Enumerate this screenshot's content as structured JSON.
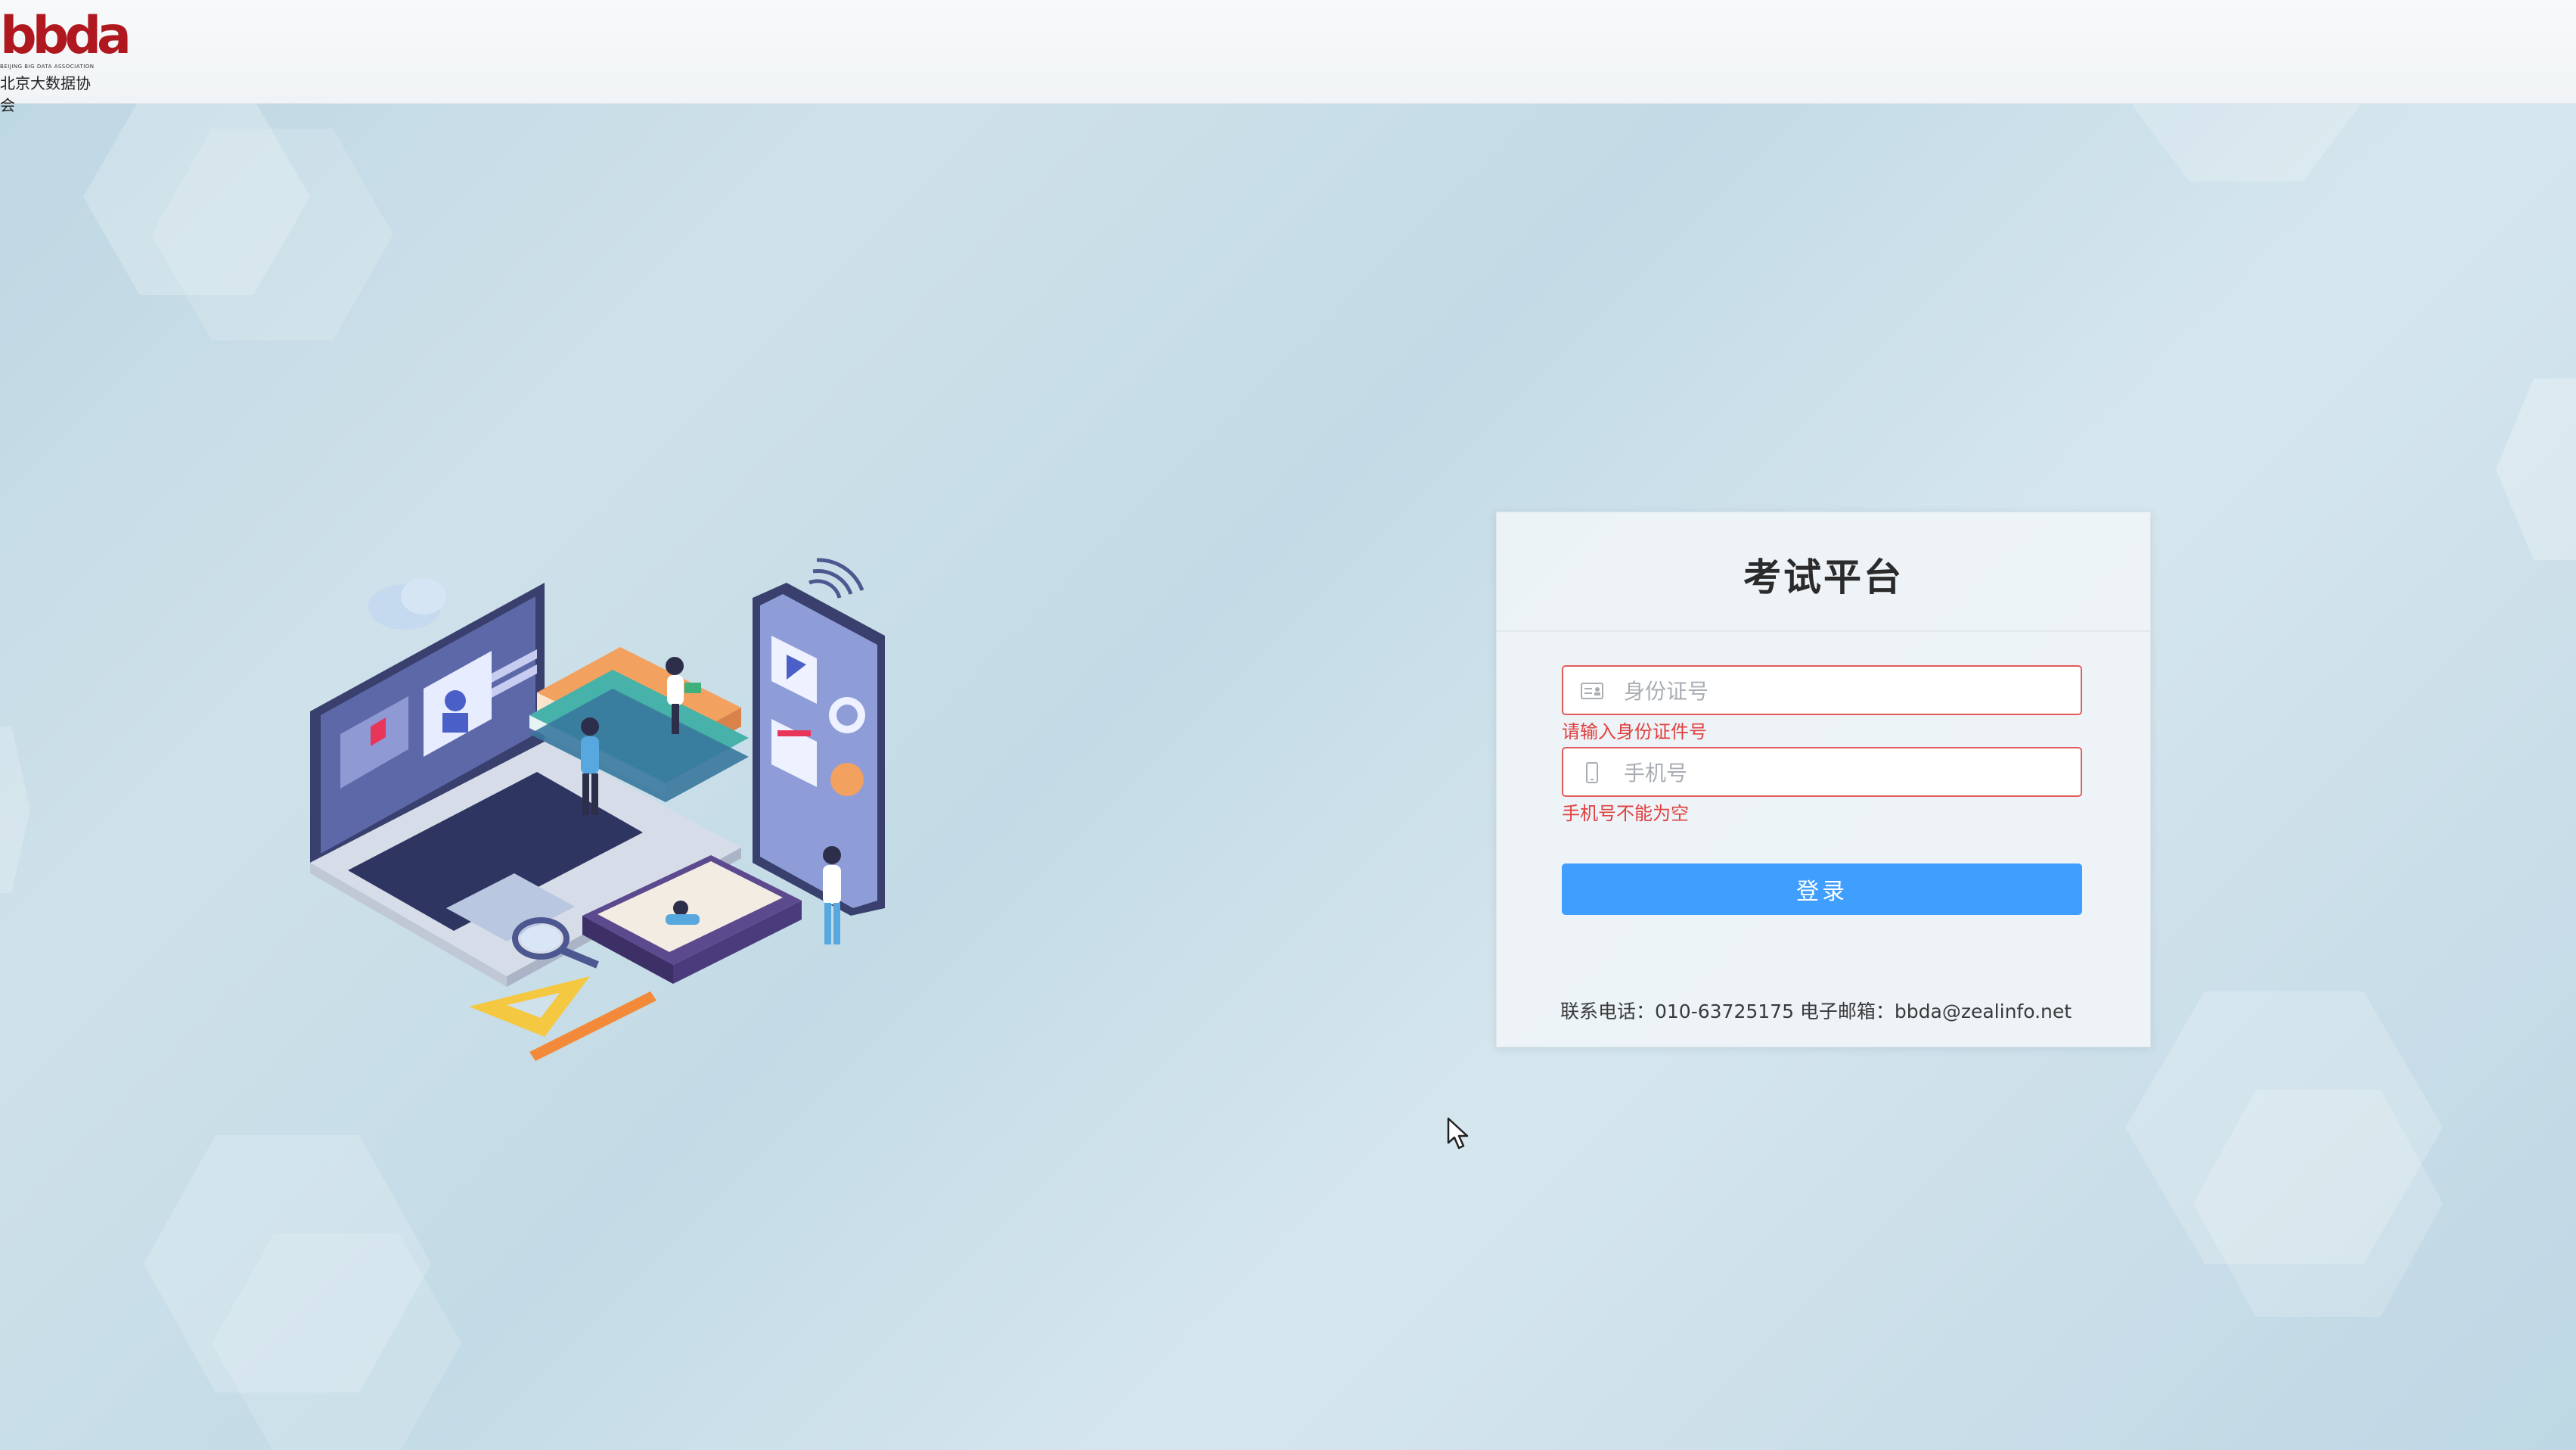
{
  "header": {
    "logo_mark": "bbda",
    "logo_sub": "BEIJING BIG DATA ASSOCIATION",
    "logo_cn": "北京大数据协会"
  },
  "login": {
    "title": "考试平台",
    "id_placeholder": "身份证号",
    "id_error": "请输入身份证件号",
    "phone_placeholder": "手机号",
    "phone_error": "手机号不能为空",
    "submit_label": "登录",
    "contact_text": "联系电话：010-63725175  电子邮箱：bbda@zealinfo.net"
  },
  "icons": {
    "id_field": "id-card-icon",
    "phone_field": "mobile-phone-icon"
  },
  "colors": {
    "primary": "#409eff",
    "error": "#e0403f",
    "brand": "#b01820"
  }
}
